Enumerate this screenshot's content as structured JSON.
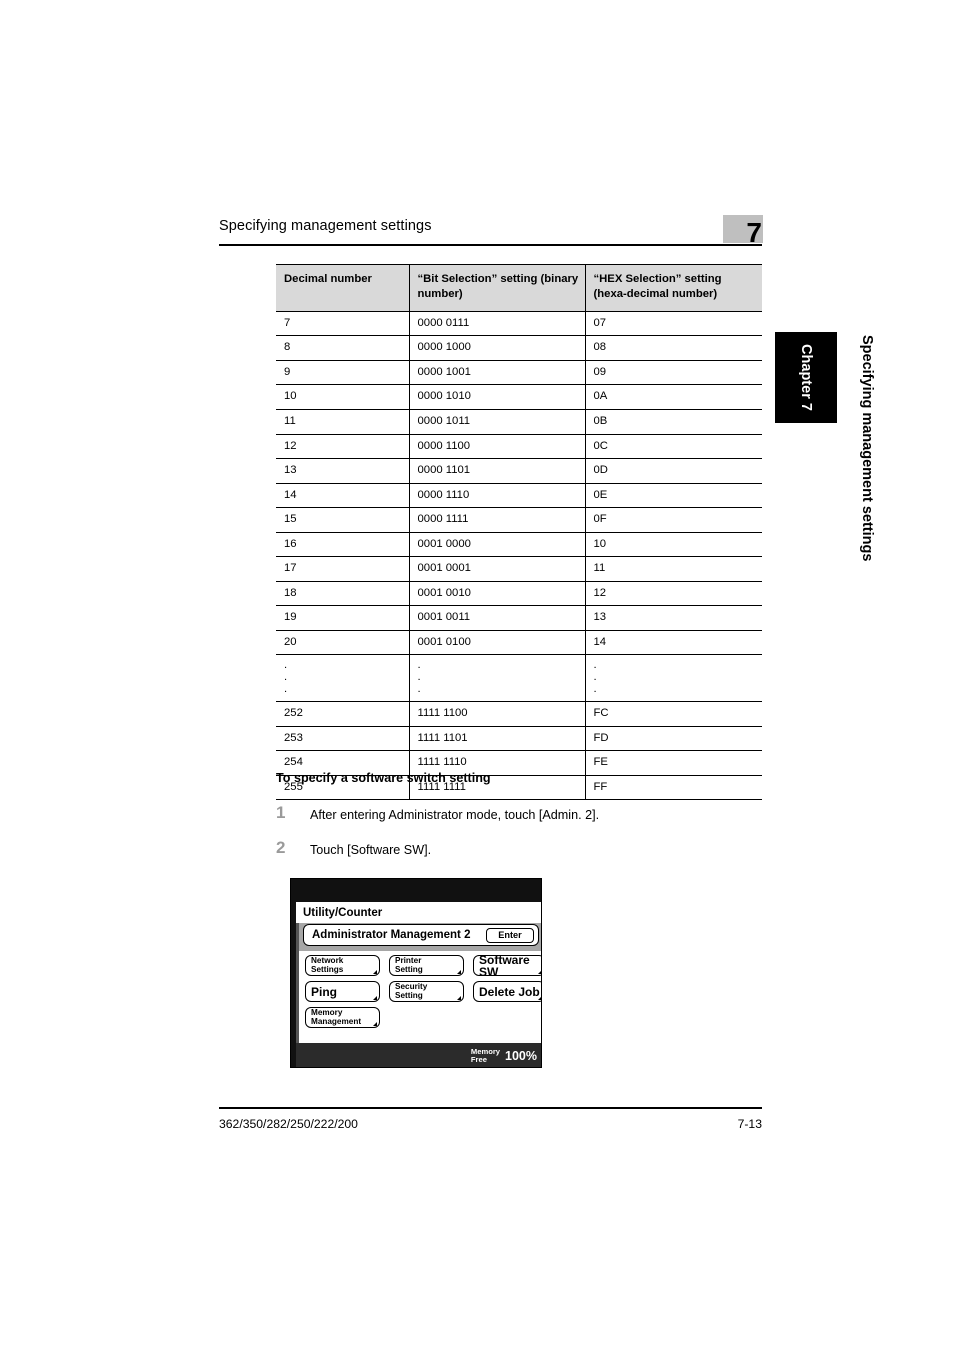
{
  "header": {
    "title": "Specifying management settings",
    "chapter_number": "7"
  },
  "side_tab": {
    "chapter_label": "Chapter 7",
    "caption": "Specifying management settings"
  },
  "table": {
    "columns": [
      "Decimal number",
      "“Bit Selection” setting (binary number)",
      "“HEX Selection” setting (hexa-decimal number)"
    ],
    "rows": [
      [
        "7",
        "0000 0111",
        "07"
      ],
      [
        "8",
        "0000 1000",
        "08"
      ],
      [
        "9",
        "0000 1001",
        "09"
      ],
      [
        "10",
        "0000 1010",
        "0A"
      ],
      [
        "11",
        "0000 1011",
        "0B"
      ],
      [
        "12",
        "0000 1100",
        "0C"
      ],
      [
        "13",
        "0000 1101",
        "0D"
      ],
      [
        "14",
        "0000 1110",
        "0E"
      ],
      [
        "15",
        "0000 1111",
        "0F"
      ],
      [
        "16",
        "0001 0000",
        "10"
      ],
      [
        "17",
        "0001 0001",
        "11"
      ],
      [
        "18",
        "0001 0010",
        "12"
      ],
      [
        "19",
        "0001 0011",
        "13"
      ],
      [
        "20",
        "0001 0100",
        "14"
      ],
      [
        ".",
        ".",
        "."
      ],
      [
        "252",
        "1111 1100",
        "FC"
      ],
      [
        "253",
        "1111 1101",
        "FD"
      ],
      [
        "254",
        "1111 1110",
        "FE"
      ],
      [
        "255",
        "1111 1111",
        "FF"
      ]
    ],
    "ellipsis_row_index": 14,
    "ellipsis_dot": "."
  },
  "procedure": {
    "heading": "To specify a software switch setting",
    "steps": [
      {
        "number": "1",
        "text": "After entering Administrator mode, touch [Admin. 2]."
      },
      {
        "number": "2",
        "text": "Touch [Software SW]."
      }
    ]
  },
  "lcd": {
    "title": "Utility/Counter",
    "section_title": "Administrator Management 2",
    "enter_label": "Enter",
    "buttons": [
      {
        "label": "Network\nSettings",
        "lines": 2
      },
      {
        "label": "Printer\nSetting",
        "lines": 2
      },
      {
        "label": "Software SW",
        "lines": 1
      },
      {
        "label": "Ping",
        "lines": 1
      },
      {
        "label": "Security\nSetting",
        "lines": 2
      },
      {
        "label": "Delete Job",
        "lines": 1
      },
      {
        "label": "Memory\nManagement",
        "lines": 2
      }
    ],
    "status": {
      "memory_label": "Memory\nFree",
      "memory_value": "100%"
    }
  },
  "footer": {
    "models": "362/350/282/250/222/200",
    "page": "7-13"
  },
  "colors": {
    "table_header_bg": "#d9d9d9",
    "chapter_marker_bg": "#bfbfbf",
    "chapter_tab_bg": "#000000",
    "step_number": "#9a9a9a",
    "lcd_band": "#a6a6a6",
    "lcd_dark": "#111111"
  }
}
